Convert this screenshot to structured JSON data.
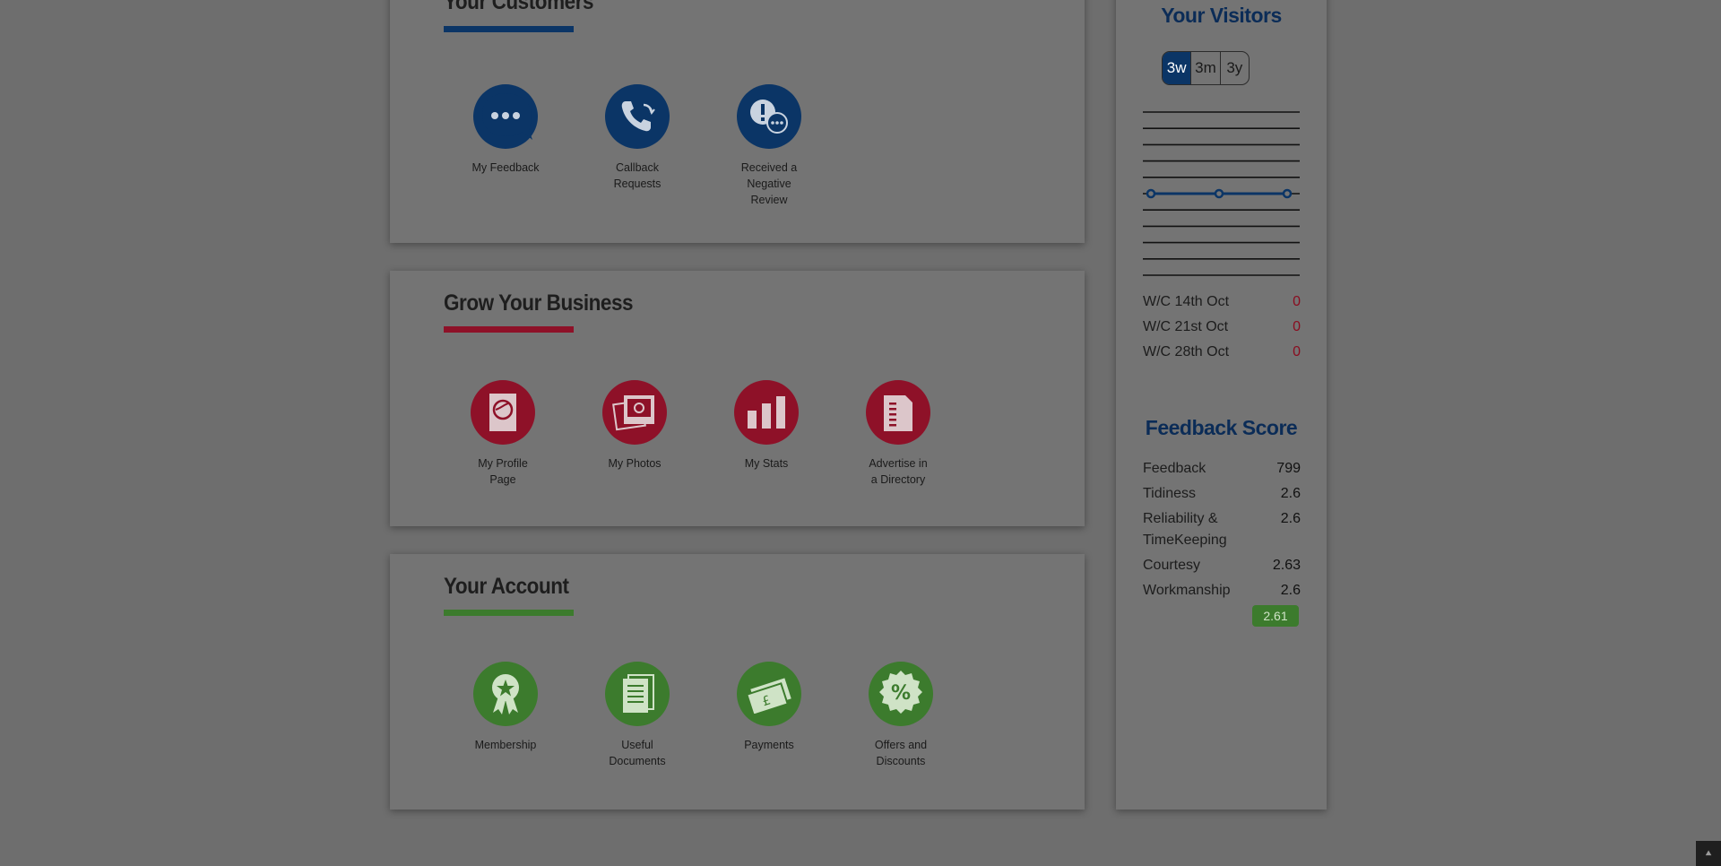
{
  "customers": {
    "title": "Your Customers",
    "underline_color": "#0b3566",
    "circle_color": "#0b3566",
    "tiles": [
      {
        "label": "My Feedback",
        "icon": "speech-bubble-icon"
      },
      {
        "label": "Callback\nRequests",
        "icon": "phone-callback-icon"
      },
      {
        "label": "Received a\nNegative\nReview",
        "icon": "negative-review-icon"
      }
    ]
  },
  "grow": {
    "title": "Grow Your Business",
    "underline_color": "#8e1128",
    "circle_color": "#8e1128",
    "tiles": [
      {
        "label": "My Profile\nPage",
        "icon": "profile-page-icon"
      },
      {
        "label": "My Photos",
        "icon": "photos-icon"
      },
      {
        "label": "My Stats",
        "icon": "bar-chart-icon"
      },
      {
        "label": "Advertise in\na Directory",
        "icon": "directory-icon"
      }
    ]
  },
  "account": {
    "title": "Your Account",
    "underline_color": "#3c7b2d",
    "circle_color": "#3c7b2d",
    "tiles": [
      {
        "label": "Membership",
        "icon": "membership-award-icon"
      },
      {
        "label": "Useful\nDocuments",
        "icon": "documents-icon"
      },
      {
        "label": "Payments",
        "icon": "payment-pound-icon"
      },
      {
        "label": "Offers and\nDiscounts",
        "icon": "percent-badge-icon"
      }
    ]
  },
  "visitors": {
    "title": "Your Visitors",
    "ranges": [
      "3w",
      "3m",
      "3y"
    ],
    "selected_range": "3w",
    "weeks": [
      {
        "label": "W/C 14th Oct",
        "value": "0"
      },
      {
        "label": "W/C 21st Oct",
        "value": "0"
      },
      {
        "label": "W/C 28th Oct",
        "value": "0"
      }
    ]
  },
  "feedback_score": {
    "title": "Feedback Score",
    "rows": [
      {
        "label": "Feedback",
        "value": "799"
      },
      {
        "label": "Tidiness",
        "value": "2.6"
      },
      {
        "label": "Reliability &\nTimeKeeping",
        "value": "2.6"
      },
      {
        "label": "Courtesy",
        "value": "2.63"
      },
      {
        "label": "Workmanship",
        "value": "2.6"
      }
    ],
    "overall": "2.61"
  },
  "chart_data": {
    "type": "line",
    "categories": [
      "W/C 14th Oct",
      "W/C 21st Oct",
      "W/C 28th Oct"
    ],
    "series": [
      {
        "values": [
          0,
          0,
          0
        ]
      }
    ],
    "grid": true
  }
}
